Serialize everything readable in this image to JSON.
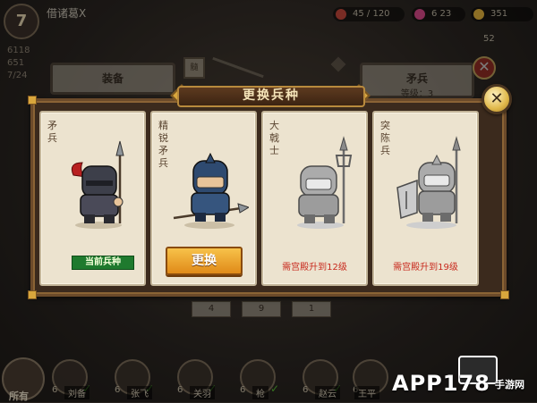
{
  "hud": {
    "player_name": "借诸葛X",
    "level": "7",
    "stamina": "45 / 120",
    "gold_small": "6 23",
    "coins": "351",
    "coins2": "52",
    "stat1": "6118",
    "stat2": "651",
    "stat3": "7/24"
  },
  "background": {
    "left_panel_title": "装备",
    "right_panel_title": "矛兵",
    "right_panel_sub": "等级：3",
    "badge_label": "髓",
    "nums": [
      "4",
      "9",
      "1"
    ]
  },
  "dialog": {
    "title": "更换兵种",
    "close_label": "✕"
  },
  "cards": [
    {
      "name": "矛兵",
      "status": "current",
      "label": "当前兵种",
      "variant": "red"
    },
    {
      "name": "精锐矛兵",
      "status": "switch",
      "label": "更换",
      "variant": "blue"
    },
    {
      "name": "大戟士",
      "status": "locked",
      "label": "需宫殿升到12级",
      "variant": "gray"
    },
    {
      "name": "突陈兵",
      "status": "locked",
      "label": "需宫殿升到19级",
      "variant": "gray"
    }
  ],
  "bottom": {
    "all_label": "所有",
    "heroes": [
      {
        "lv": "6",
        "name": "刘备"
      },
      {
        "lv": "6",
        "name": "张飞"
      },
      {
        "lv": "6",
        "name": "关羽"
      },
      {
        "lv": "6",
        "name": "枪"
      },
      {
        "lv": "6",
        "name": "赵云"
      },
      {
        "lv": "6",
        "name": "王平"
      }
    ]
  },
  "watermark": {
    "text": "APP178",
    "sub": "手游网"
  },
  "colors": {
    "dialog_bg": "#3b2a1d",
    "card_bg": "#ece3cf",
    "current_green": "#1f7a2e",
    "switch_orange": "#e08a18",
    "req_red": "#c82a1e"
  }
}
